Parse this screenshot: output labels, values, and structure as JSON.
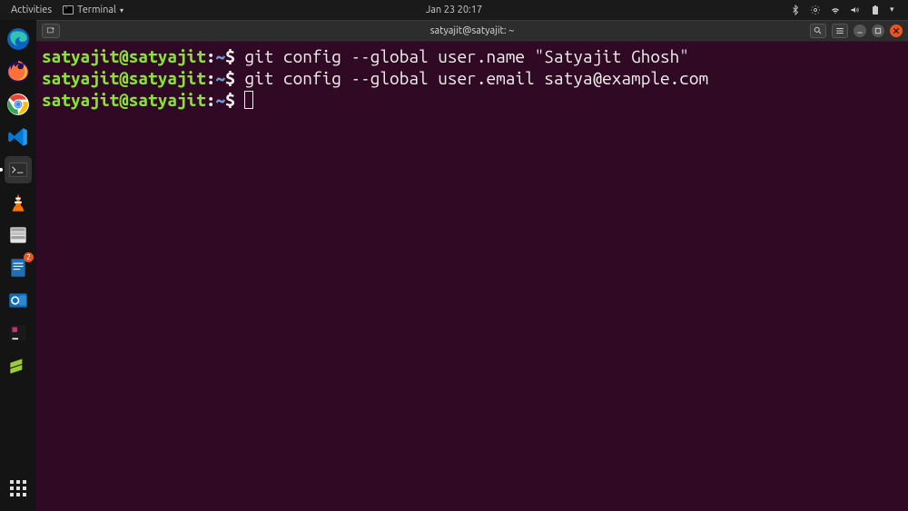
{
  "top_bar": {
    "activities_label": "Activities",
    "app_name": "Terminal",
    "datetime": "Jan 23  20:17"
  },
  "dock": {
    "badge_count": "2"
  },
  "window": {
    "title": "satyajit@satyajit: ~"
  },
  "terminal": {
    "lines": [
      {
        "user_host": "satyajit@satyajit",
        "path": "~",
        "command": "git config --global user.name \"Satyajit Ghosh\""
      },
      {
        "user_host": "satyajit@satyajit",
        "path": "~",
        "command": "git config --global user.email satya@example.com"
      },
      {
        "user_host": "satyajit@satyajit",
        "path": "~",
        "command": ""
      }
    ]
  }
}
